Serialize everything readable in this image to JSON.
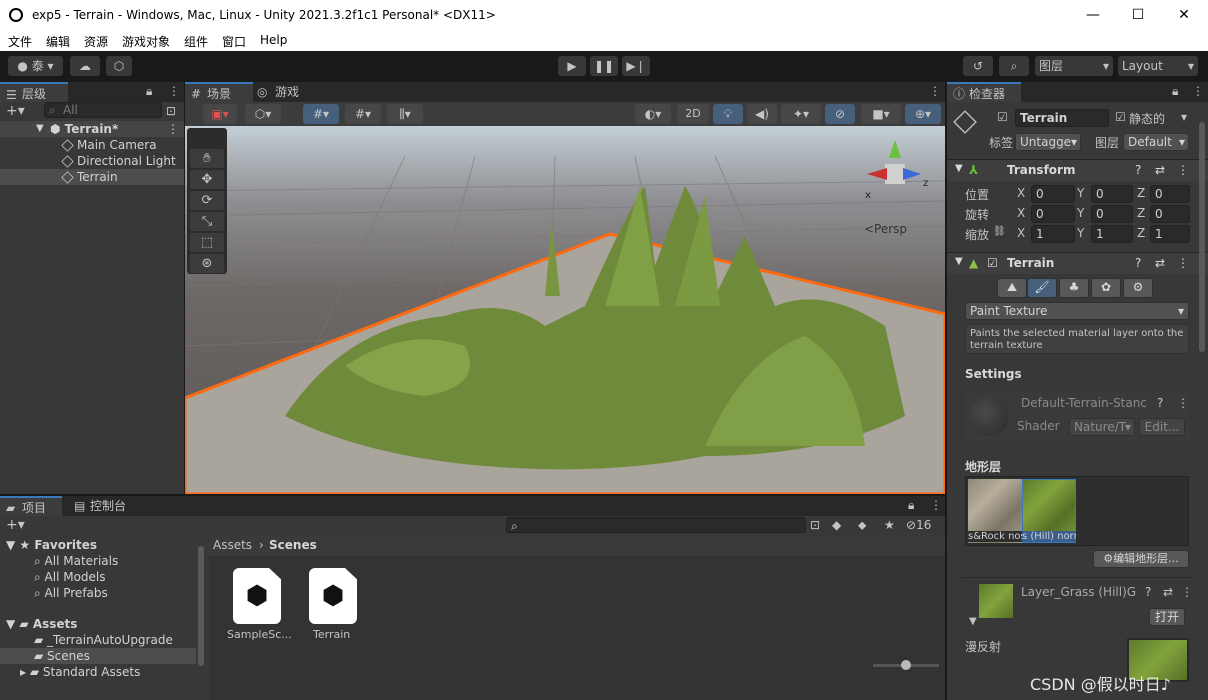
{
  "window": {
    "title": "exp5 - Terrain - Windows, Mac, Linux - Unity 2021.3.2f1c1 Personal* <DX11>",
    "minimize": "—",
    "maximize": "☐",
    "close": "✕"
  },
  "menu": [
    "文件",
    "编辑",
    "资源",
    "游戏对象",
    "组件",
    "窗口",
    "Help"
  ],
  "toolbar": {
    "account": "泰",
    "layers": "图层",
    "layout": "Layout"
  },
  "hierarchy": {
    "tab": "层级",
    "search_placeholder": "All",
    "scene": "Terrain*",
    "items": [
      "Main Camera",
      "Directional Light",
      "Terrain"
    ]
  },
  "scene_view": {
    "tab_scene": "场景",
    "tab_game": "游戏",
    "btn_2d": "2D",
    "persp": "<Persp",
    "axis_x": "x",
    "axis_z": "z"
  },
  "inspector": {
    "tab": "检查器",
    "object_name": "Terrain",
    "static_label": "静态的",
    "tag_label": "标签",
    "tag_value": "Untagge",
    "layer_label": "图层",
    "layer_value": "Default",
    "transform": {
      "title": "Transform",
      "rows": [
        {
          "label": "位置",
          "x": "0",
          "y": "0",
          "z": "0"
        },
        {
          "label": "旋转",
          "x": "0",
          "y": "0",
          "z": "0"
        },
        {
          "label": "缩放",
          "x": "1",
          "y": "1",
          "z": "1"
        }
      ],
      "x_label": "X",
      "y_label": "Y",
      "z_label": "Z"
    },
    "terrain": {
      "title": "Terrain",
      "mode": "Paint Texture",
      "help": "Paints the selected material layer onto the terrain texture",
      "settings": "Settings",
      "material": "Default-Terrain-Stanc",
      "shader_label": "Shader",
      "shader_value": "Nature/T",
      "edit": "Edit...",
      "layers_title": "地形层",
      "layer1": "s&Rock nos",
      "layer2": "s (Hill) norr",
      "edit_layers": "编辑地形层...",
      "layer_name": "Layer_Grass (Hill)G",
      "open": "打开",
      "diffuse": "漫反射"
    }
  },
  "project": {
    "tab_project": "项目",
    "tab_console": "控制台",
    "hidden_count": "16",
    "favorites": "Favorites",
    "fav_items": [
      "All Materials",
      "All Models",
      "All Prefabs"
    ],
    "assets": "Assets",
    "asset_items": [
      "_TerrainAutoUpgrade",
      "Scenes",
      "Standard Assets"
    ],
    "breadcrumb_root": "Assets",
    "breadcrumb_leaf": "Scenes",
    "files": [
      "SampleSc...",
      "Terrain"
    ]
  },
  "watermark": "CSDN @假以时日♪"
}
